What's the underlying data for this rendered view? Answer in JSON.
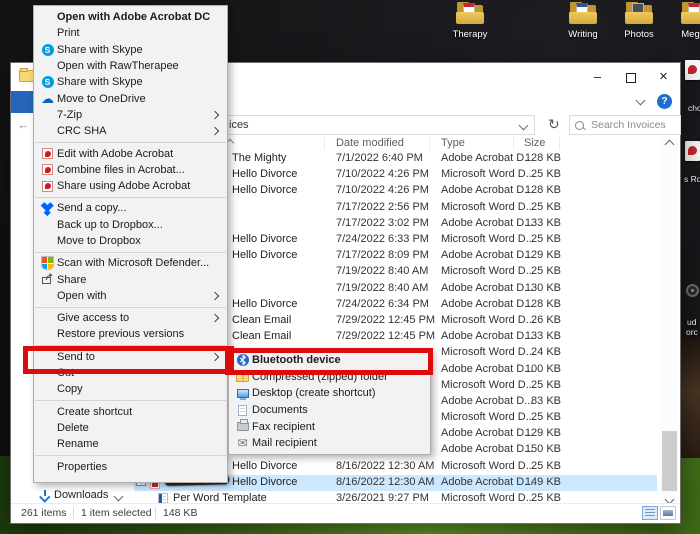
{
  "highlight_color": "#dd0b0b",
  "glyphs": {
    "minimize": "–",
    "close": "×",
    "help": "?",
    "refresh": "↻",
    "back": "←",
    "skype": "S",
    "cloud": "☁",
    "mail": "✉"
  },
  "desktop": {
    "icons": [
      {
        "label": "Therapy",
        "page_style": "pdf",
        "page_color": "#c9252d"
      },
      {
        "label": "Writing",
        "page_style": "doc",
        "page_color": "#2b579a"
      },
      {
        "label": "Photos",
        "page_style": "photo",
        "page_color": "#4a4f55"
      },
      {
        "label": "Meg S",
        "page_style": "pdf",
        "page_color": "#c9252d"
      }
    ],
    "edge_labels": [
      "cho",
      "s Ro",
      "ud",
      "orc"
    ]
  },
  "window": {
    "address_visible_text": "ices",
    "search": {
      "placeholder": "Search Invoices"
    },
    "columns": {
      "date": "Date modified",
      "type": "Type",
      "size": "Size"
    },
    "sidebar": {
      "downloads": "Downloads"
    },
    "status": {
      "items": "261 items",
      "selected": "1 item selected",
      "size": "148 KB"
    }
  },
  "files": [
    {
      "name": "The Mighty",
      "date": "7/1/2022 6:40 PM",
      "type": "Adobe Acrobat D...",
      "size": "128 KB"
    },
    {
      "name": "Hello Divorce",
      "date": "7/10/2022 4:26 PM",
      "type": "Microsoft Word D...",
      "size": "25 KB"
    },
    {
      "name": "Hello Divorce",
      "date": "7/10/2022 4:26 PM",
      "type": "Adobe Acrobat D...",
      "size": "128 KB"
    },
    {
      "name": "",
      "date": "7/17/2022 2:56 PM",
      "type": "Microsoft Word D...",
      "size": "25 KB"
    },
    {
      "name": "",
      "date": "7/17/2022 3:02 PM",
      "type": "Adobe Acrobat D...",
      "size": "133 KB"
    },
    {
      "name": "Hello Divorce",
      "date": "7/24/2022 6:33 PM",
      "type": "Microsoft Word D...",
      "size": "25 KB"
    },
    {
      "name": "Hello Divorce",
      "date": "7/17/2022 8:09 PM",
      "type": "Adobe Acrobat D...",
      "size": "129 KB"
    },
    {
      "name": "",
      "date": "7/19/2022 8:40 AM",
      "type": "Microsoft Word D...",
      "size": "25 KB"
    },
    {
      "name": "",
      "date": "7/19/2022 8:40 AM",
      "type": "Adobe Acrobat D...",
      "size": "130 KB"
    },
    {
      "name": "Hello Divorce",
      "date": "7/24/2022 6:34 PM",
      "type": "Adobe Acrobat D...",
      "size": "128 KB"
    },
    {
      "name": "Clean Email",
      "date": "7/29/2022 12:45 PM",
      "type": "Microsoft Word D...",
      "size": "26 KB"
    },
    {
      "name": "Clean Email",
      "date": "7/29/2022 12:45 PM",
      "type": "Adobe Acrobat D...",
      "size": "133 KB"
    },
    {
      "name": "",
      "date": "",
      "type": "Microsoft Word D...",
      "size": "24 KB"
    },
    {
      "name": "",
      "date": "",
      "type": "Adobe Acrobat D...",
      "size": "100 KB"
    },
    {
      "name": "",
      "date": "",
      "type": "Microsoft Word D...",
      "size": "25 KB"
    },
    {
      "name": "",
      "date": "",
      "type": "Adobe Acrobat D...",
      "size": "83 KB"
    },
    {
      "name": "",
      "date": "",
      "type": "Microsoft Word D...",
      "size": "25 KB"
    },
    {
      "name": "",
      "date": "",
      "type": "Adobe Acrobat D...",
      "size": "129 KB"
    },
    {
      "name": "",
      "date": "",
      "type": "Adobe Acrobat D...",
      "size": "150 KB"
    },
    {
      "name": "Hello Divorce",
      "date": "8/16/2022 12:30 AM",
      "type": "Microsoft Word D...",
      "size": "25 KB"
    },
    {
      "name": "Hello Divorce",
      "date": "8/16/2022 12:30 AM",
      "type": "Adobe Acrobat D...",
      "size": "149 KB",
      "selected": true,
      "redacted": true,
      "icon": "pdf"
    },
    {
      "name": "Per Word Template",
      "date": "3/26/2021 9:27 PM",
      "type": "Microsoft Word D...",
      "size": "25 KB",
      "icon": "word"
    }
  ],
  "context_menu": {
    "items": [
      {
        "label": "Open with Adobe Acrobat DC",
        "bold": true
      },
      {
        "label": "Print"
      },
      {
        "label": "Share with Skype",
        "icon": "skype"
      },
      {
        "label": "Open with RawTherapee"
      },
      {
        "label": "Share with Skype",
        "icon": "skype"
      },
      {
        "label": "Move to OneDrive",
        "icon": "onedrive"
      },
      {
        "label": "7-Zip",
        "submenu": true
      },
      {
        "label": "CRC SHA",
        "submenu": true,
        "sep": true
      },
      {
        "label": "Edit with Adobe Acrobat",
        "icon": "acrobat"
      },
      {
        "label": "Combine files in Acrobat...",
        "icon": "acrobat"
      },
      {
        "label": "Share using Adobe Acrobat",
        "icon": "acrobat",
        "sep": true
      },
      {
        "label": "Send a copy...",
        "icon": "dropbox"
      },
      {
        "label": "Back up to Dropbox..."
      },
      {
        "label": "Move to Dropbox",
        "sep": true
      },
      {
        "label": "Scan with Microsoft Defender...",
        "icon": "defender"
      },
      {
        "label": "Share",
        "icon": "share"
      },
      {
        "label": "Open with",
        "submenu": true,
        "sep": true
      },
      {
        "label": "Give access to",
        "submenu": true
      },
      {
        "label": "Restore previous versions",
        "sep": true
      },
      {
        "label": "Send to",
        "submenu": true,
        "highlighted": true
      },
      {
        "label": "Cut"
      },
      {
        "label": "Copy",
        "sep": true
      },
      {
        "label": "Create shortcut"
      },
      {
        "label": "Delete"
      },
      {
        "label": "Rename",
        "sep": true
      },
      {
        "label": "Properties"
      }
    ]
  },
  "send_to_menu": {
    "items": [
      {
        "label": "Bluetooth device",
        "icon": "bluetooth",
        "highlighted": true
      },
      {
        "label": "Compressed (zipped) folder",
        "icon": "zipfolder"
      },
      {
        "label": "Desktop (create shortcut)",
        "icon": "monitor"
      },
      {
        "label": "Documents",
        "icon": "document"
      },
      {
        "label": "Fax recipient",
        "icon": "fax"
      },
      {
        "label": "Mail recipient",
        "icon": "mail"
      }
    ]
  }
}
